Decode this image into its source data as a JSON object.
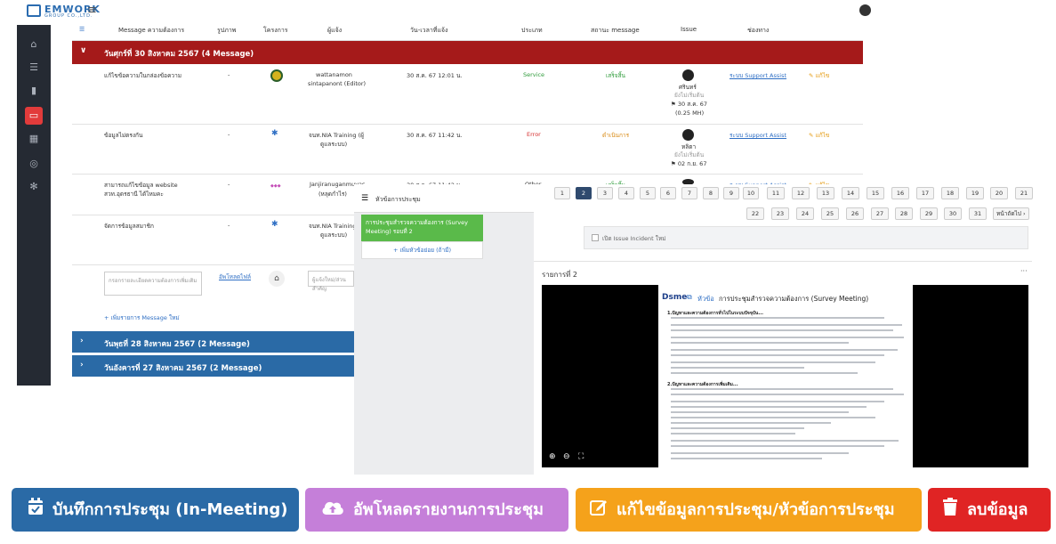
{
  "topbar": {
    "logo_text": "EMWORK",
    "logo_sub": "GROUP CO.,LTD."
  },
  "sidebar": {
    "icons": [
      "home-icon",
      "list-icon",
      "chart-icon",
      "chat-icon",
      "calendar-icon",
      "check-circle-icon",
      "gear-icon"
    ],
    "active_index": 3
  },
  "table": {
    "headers": [
      "Message ความต้องการ",
      "รูปภาพ",
      "โครงการ",
      "ผู้แจ้ง",
      "วัน-เวลาที่แจ้ง",
      "ประเภท",
      "สถานะ message",
      "Issue",
      "ช่องทาง"
    ],
    "group_open": "วันศุกร์ที่ 30 สิงหาคม 2567 (4 Message)",
    "rows": [
      {
        "message": "แก้ไขข้อความในกล่องข้อความ",
        "image": "-",
        "reporter": "wattanamon",
        "reporter2": "sintapanont (Editor)",
        "datetime": "30 ส.ค. 67 12:01 น.",
        "type": "Service",
        "status": "เสร็จสิ้น",
        "issue_name": "ศรินทร์",
        "issue_state": "ยังไม่เริ่มต้น",
        "issue_date": "30 ส.ค. 67",
        "issue_hours": "(0.25 MH)",
        "channel": "ระบบ Support Assist",
        "edit": "แก้ไข"
      },
      {
        "message": "ข้อมูลไม่ตรงกัน",
        "image": "-",
        "reporter": "จนท.NIA Training (ผู้",
        "reporter2": "ดูแลระบบ)",
        "datetime": "30 ส.ค. 67 11:42 น.",
        "type": "Error",
        "status": "ดำเนินการ",
        "issue_name": "หลิตา",
        "issue_state": "ยังไม่เริ่มต้น",
        "issue_date": "02 ก.ย. 67",
        "issue_hours": "",
        "channel": "ระบบ Support Assist",
        "edit": "แก้ไข"
      },
      {
        "message": "สามารถแก้ไขข้อมูล website",
        "message2": "สวท.อุดรธานี ได้ไหมคะ",
        "image": "-",
        "reporter": "Janjiranuganmuvas",
        "reporter2": "(หลุดกำไร)",
        "datetime": "30 ส.ค. 67 11:42 น.",
        "type": "Other",
        "status": "เสร็จสิ้น",
        "channel": "ระบบ Support Assist",
        "edit": "แก้ไข"
      },
      {
        "message": "จัดการข้อมูลสมาชิก",
        "image": "-",
        "reporter": "จนท.NIA Training (ผู้",
        "reporter2": "ดูแลระบบ)"
      }
    ],
    "new_message_placeholder": "กรอกรายละเอียดความต้องการเพิ่มเติม",
    "upload_link": "อัพโหลดไฟล์",
    "reporter_placeholder": "ผู้แจ้งใหม่/ส่วนสำคัญ",
    "add_message": "+ เพิ่มรายการ Message ใหม่",
    "group_closed_1": "วันพุธที่ 28 สิงหาคม 2567 (2 Message)",
    "group_closed_2": "วันอังคารที่ 27 สิงหาคม 2567 (2 Message)"
  },
  "agenda_panel": {
    "title": "หัวข้อการประชุม",
    "card": "การประชุมสำรวจความต้องการ (Survey Meeting) รอบที่ 2",
    "add": "+ เพิ่มหัวข้อย่อย (ถ้ามี)"
  },
  "pagination": {
    "row1": [
      "1",
      "2",
      "3",
      "4",
      "5",
      "6",
      "7",
      "8",
      "9",
      "10",
      "11",
      "12",
      "13",
      "14",
      "15",
      "16",
      "17",
      "18",
      "19",
      "20",
      "21"
    ],
    "row2": [
      "22",
      "23",
      "24",
      "25",
      "26",
      "27",
      "28",
      "29",
      "30",
      "31"
    ],
    "active": "2",
    "next_label": "หน้าถัดไป ›"
  },
  "incident_label": "เปิด Issue Incident ใหม่",
  "item": {
    "label": "รายการที่ 2",
    "menu": "···"
  },
  "doc": {
    "logo": "Dsme",
    "title_prefix": "หัวข้อ",
    "title": "การประชุมสำรวจความต้องการ (Survey Meeting)",
    "section1": "1.ปัญหาและความต้องการทั่วไปในระบบปัจจุบัน...",
    "section2": "2.ปัญหาและความต้องการเพิ่มเติม..."
  },
  "viewer_controls": [
    "zoom-in-icon",
    "zoom-out-icon",
    "fullscreen-icon"
  ],
  "buttons": {
    "record": "บันทึกการประชุม (In-Meeting)",
    "upload": "อัพโหลดรายงานการประชุม",
    "edit": "แก้ไขข้อมูลการประชุม/หัวข้อการประชุม",
    "delete": "ลบข้อมูล"
  },
  "colors": {
    "record": "#2a6aa6",
    "upload": "#c57fd9",
    "edit": "#f5a21b",
    "delete": "#e02424",
    "group_red": "#a51a1a",
    "group_blue": "#2a6aa6"
  }
}
